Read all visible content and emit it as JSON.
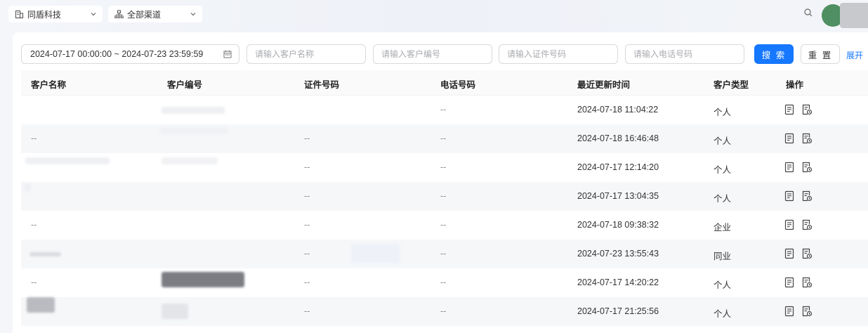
{
  "topbar": {
    "company_select": "同盾科技",
    "channel_select": "全部渠道"
  },
  "filters": {
    "date_range": "2024-07-17 00:00:00 ~ 2024-07-23 23:59:59",
    "customer_name_placeholder": "请输入客户名称",
    "customer_no_placeholder": "请输入客户编号",
    "id_no_placeholder": "请输入证件号码",
    "phone_placeholder": "请输入电话号码",
    "search_label": "搜 索",
    "reset_label": "重 置",
    "expand_label": "展开"
  },
  "table": {
    "columns": [
      "客户名称",
      "客户编号",
      "证件号码",
      "电话号码",
      "最近更新时间",
      "客户类型",
      "操作"
    ],
    "rows": [
      {
        "name": "",
        "no": "",
        "id": "",
        "phone": "--",
        "updated": "2024-07-18 11:04:22",
        "type": "个人"
      },
      {
        "name": "--",
        "no": "",
        "id": "--",
        "phone": "--",
        "updated": "2024-07-18 16:46:48",
        "type": "个人"
      },
      {
        "name": "",
        "no": "",
        "id": "--",
        "phone": "--",
        "updated": "2024-07-17 12:14:20",
        "type": "个人"
      },
      {
        "name": "",
        "no": "",
        "id": "--",
        "phone": "--",
        "updated": "2024-07-17 13:04:35",
        "type": "个人"
      },
      {
        "name": "--",
        "no": "",
        "id": "--",
        "phone": "--",
        "updated": "2024-07-18 09:38:32",
        "type": "企业"
      },
      {
        "name": "",
        "no": "",
        "id": "--",
        "phone": "--",
        "updated": "2024-07-23 13:55:43",
        "type": "同业"
      },
      {
        "name": "--",
        "no": "",
        "id": "--",
        "phone": "--",
        "updated": "2024-07-17 14:20:22",
        "type": "个人"
      },
      {
        "name": "",
        "no": "",
        "id": "--",
        "phone": "--",
        "updated": "2024-07-17 21:25:56",
        "type": "个人"
      }
    ],
    "action_icons": [
      "detail-icon",
      "edit-record-icon"
    ]
  },
  "colors": {
    "primary": "#1677ff",
    "row_alt": "#f6f7f9",
    "header_bg": "#fafafa"
  }
}
